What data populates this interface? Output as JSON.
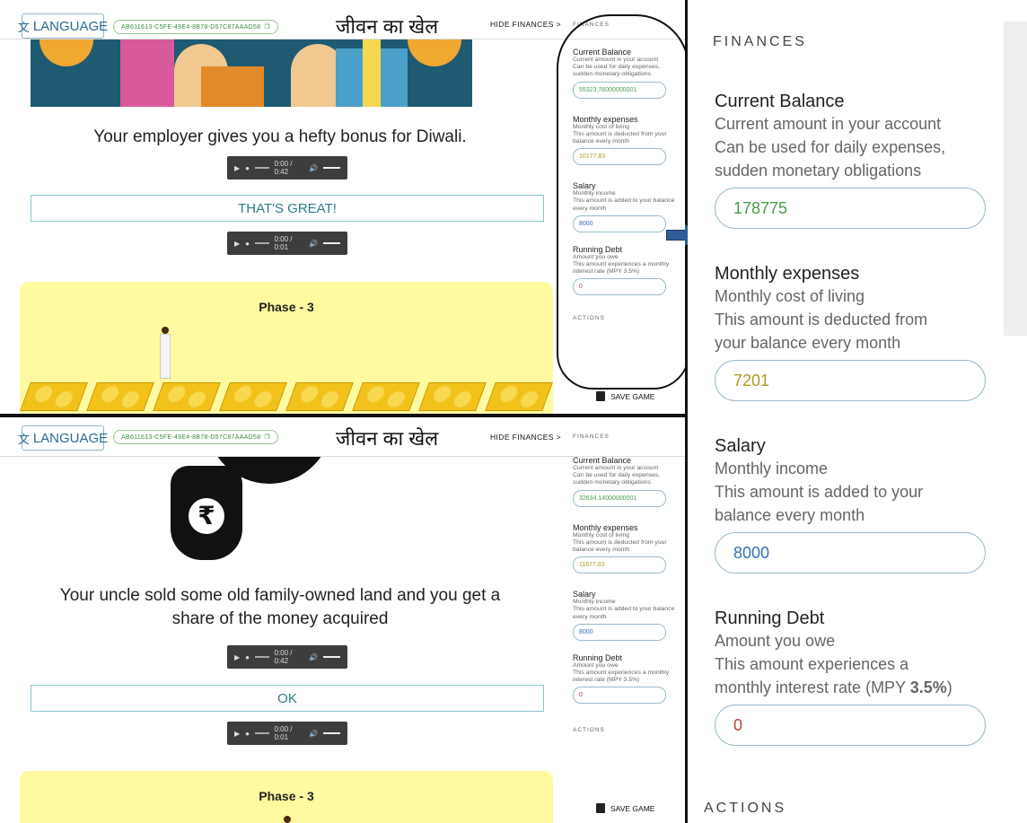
{
  "app": {
    "language_label": "LANGUAGE",
    "session_id": "AB611613-C5FE-49E4-8B78-D57C87AAAD58",
    "title": "जीवन का खेल",
    "hide_finances": "HIDE FINANCES",
    "hide_finances_chevron": ">"
  },
  "top": {
    "story": "Your employer gives you a hefty bonus for Diwali.",
    "story_audio_time": "0:00 / 0:42",
    "choice": "THAT'S GREAT!",
    "choice_audio_time": "0:00 / 0:01",
    "phase": "Phase - 3",
    "finances": {
      "caption": "FINANCES",
      "current_balance": {
        "label": "Current Balance",
        "desc1": "Current amount in your account",
        "desc2": "Can be used for daily expenses, sudden monetary obligations",
        "value": "55323.76000000001"
      },
      "monthly_expenses": {
        "label": "Monthly expenses",
        "desc1": "Monthly cost of living",
        "desc2": "This amount is deducted from your balance every month",
        "value": "10177.83"
      },
      "salary": {
        "label": "Salary",
        "desc1": "Monthly income",
        "desc2": "This amount is added to your balance every month",
        "value": "8000"
      },
      "running_debt": {
        "label": "Running Debt",
        "desc1": "Amount you owe",
        "desc2": "This amount experiences a monthly interest rate (MPY 3.5%)",
        "value": "0"
      },
      "actions": "ACTIONS",
      "save_game": "SAVE GAME"
    }
  },
  "bottom": {
    "story": "Your uncle sold some old family-owned land and you get a share of the money acquired",
    "story_audio_time": "0:00 / 0:42",
    "choice": "OK",
    "choice_audio_time": "0:00 / 0:01",
    "phase": "Phase - 3",
    "rupee": "₹",
    "finances": {
      "caption": "FINANCES",
      "current_balance": {
        "label": "Current Balance",
        "desc1": "Current amount in your account",
        "desc2": "Can be used for daily expenses, sudden monetary obligations",
        "value": "32634.14000000001"
      },
      "monthly_expenses": {
        "label": "Monthly expenses",
        "desc1": "Monthly cost of living",
        "desc2": "This amount is deducted from your balance every month",
        "value": "11677.83"
      },
      "salary": {
        "label": "Salary",
        "desc1": "Monthly income",
        "desc2": "This amount is added to your balance every month",
        "value": "8000"
      },
      "running_debt": {
        "label": "Running Debt",
        "desc1": "Amount you owe",
        "desc2": "This amount experiences a monthly interest rate (MPY 3.5%)",
        "value": "0"
      },
      "actions": "ACTIONS",
      "save_game": "SAVE GAME"
    }
  },
  "zoom": {
    "caption": "FINANCES",
    "current_balance": {
      "label": "Current Balance",
      "desc1": "Current amount in your account",
      "desc2": "Can be used for daily expenses,",
      "desc3": "sudden monetary obligations",
      "value": "178775"
    },
    "monthly_expenses": {
      "label": "Monthly expenses",
      "desc1": "Monthly cost of living",
      "desc2": "This amount is deducted from",
      "desc3": "your balance every month",
      "value": "7201"
    },
    "salary": {
      "label": "Salary",
      "desc1": "Monthly income",
      "desc2": "This amount is added to your",
      "desc3": "balance every month",
      "value": "8000"
    },
    "running_debt": {
      "label": "Running Debt",
      "desc1": "Amount you owe",
      "desc2": "This amount experiences a",
      "desc3_pre": "monthly interest rate (MPY ",
      "desc3_bold": "3.5%",
      "desc3_post": ")",
      "value": "0"
    },
    "actions": "ACTIONS"
  },
  "colors": {
    "balance": "#4b9a4b",
    "expenses": "#b09a22",
    "salary": "#3470b8",
    "debt": "#b04444",
    "phase_bg": "#fffaa0",
    "arrow": "#2e5c9a"
  }
}
